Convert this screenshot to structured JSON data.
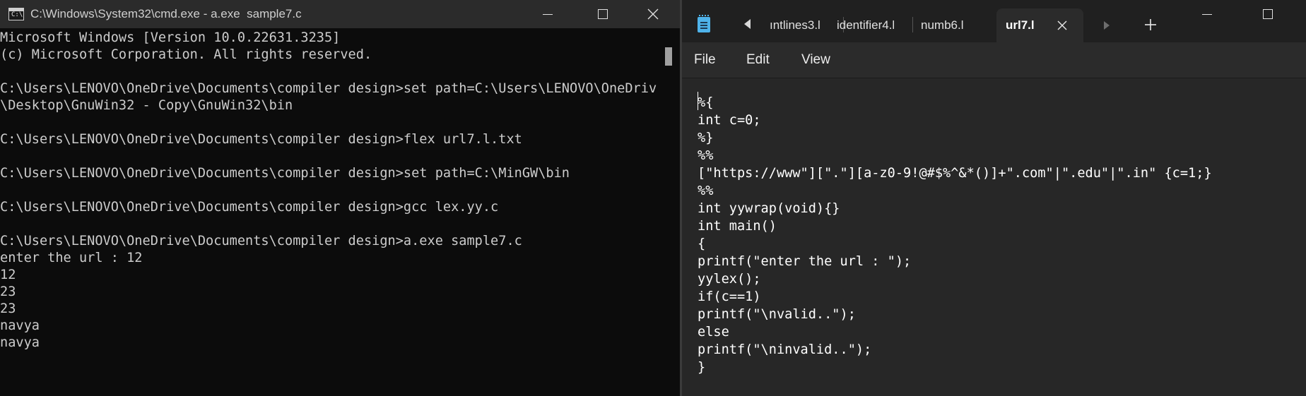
{
  "cmd": {
    "title": "C:\\Windows\\System32\\cmd.exe - a.exe  sample7.c",
    "icon": "cmd-console-icon",
    "icon_text": "C:\\",
    "lines": [
      "Microsoft Windows [Version 10.0.22631.3235]",
      "(c) Microsoft Corporation. All rights reserved.",
      "",
      "C:\\Users\\LENOVO\\OneDrive\\Documents\\compiler design>set path=C:\\Users\\LENOVO\\OneDrive",
      "\\Desktop\\GnuWin32 - Copy\\GnuWin32\\bin",
      "",
      "C:\\Users\\LENOVO\\OneDrive\\Documents\\compiler design>flex url7.l.txt",
      "",
      "C:\\Users\\LENOVO\\OneDrive\\Documents\\compiler design>set path=C:\\MinGW\\bin",
      "",
      "C:\\Users\\LENOVO\\OneDrive\\Documents\\compiler design>gcc lex.yy.c",
      "",
      "C:\\Users\\LENOVO\\OneDrive\\Documents\\compiler design>a.exe sample7.c",
      "enter the url : 12",
      "12",
      "23",
      "23",
      "navya",
      "navya"
    ]
  },
  "notepad": {
    "icon": "notepad-icon",
    "tabs": [
      {
        "label": "ıntlines3.l",
        "active": false
      },
      {
        "label": "identifier4.l",
        "active": false
      },
      {
        "label": "numb6.l",
        "active": false
      },
      {
        "label": "url7.l",
        "active": true
      }
    ],
    "menu": [
      "File",
      "Edit",
      "View"
    ],
    "code_lines": [
      "%{",
      "int c=0;",
      "%}",
      "%%",
      "[\"https://www\"][\".\"][a-z0-9!@#$%^&*()]+\".com\"|\".edu\"|\".in\" {c=1;}",
      "%%",
      "int yywrap(void){}",
      "int main()",
      "{",
      "printf(\"enter the url : \");",
      "yylex();",
      "if(c==1)",
      "printf(\"\\nvalid..\");",
      "else",
      "printf(\"\\ninvalid..\");",
      "}"
    ]
  },
  "colors": {
    "cmd_background": "#0c0c0c",
    "cmd_text": "#cccccc",
    "notepad_background": "#272727",
    "notepad_text": "#ffffff"
  }
}
